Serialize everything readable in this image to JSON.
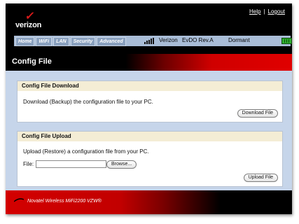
{
  "header": {
    "logo_text": "verizon",
    "links": {
      "help": "Help",
      "separator": "|",
      "logout": "Logout"
    }
  },
  "nav": {
    "tabs": [
      {
        "label": "Home"
      },
      {
        "label": "WiFi"
      },
      {
        "label": "LAN"
      },
      {
        "label": "Security"
      },
      {
        "label": "Advanced"
      }
    ],
    "carrier": "Verizon",
    "technology": "EvDO Rev.A",
    "connection_state": "Dormant",
    "signal_icon": "signal-bars-icon",
    "battery_icon": "battery-icon"
  },
  "page": {
    "title": "Config File"
  },
  "download": {
    "header": "Config File Download",
    "description": "Download (Backup) the configuration file to your PC.",
    "button": "Download File"
  },
  "upload": {
    "header": "Config File Upload",
    "description": "Upload (Restore) a configuration file from your PC.",
    "file_label": "File:",
    "file_value": "",
    "browse_button": "Browse...",
    "button": "Upload File"
  },
  "footer": {
    "brand": "Novatel Wireless MiFi2200 VZW®"
  },
  "colors": {
    "accent_red": "#d00000",
    "nav_blue": "#a9bdd7",
    "content_bg": "#c6d5ea",
    "panel_header": "#f4edd5"
  }
}
